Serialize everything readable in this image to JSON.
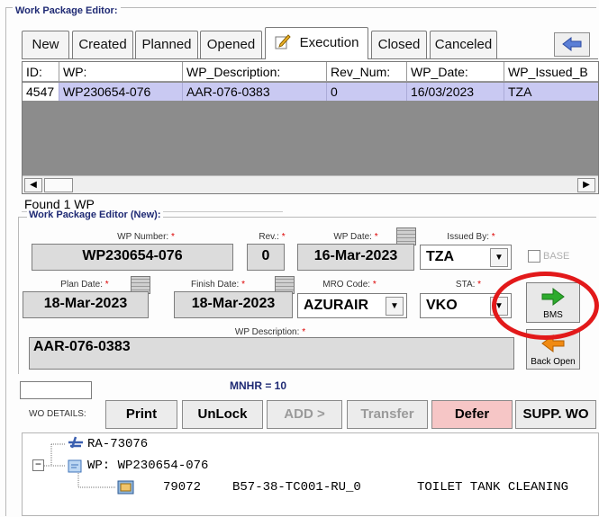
{
  "window": {
    "title": "Work Package Editor:"
  },
  "tabs": [
    {
      "label": "New"
    },
    {
      "label": "Created"
    },
    {
      "label": "Planned"
    },
    {
      "label": "Opened"
    },
    {
      "label": "Execution",
      "active": true
    },
    {
      "label": "Closed"
    },
    {
      "label": "Canceled"
    }
  ],
  "grid": {
    "columns": [
      "ID:",
      "WP:",
      "WP_Description:",
      "Rev_Num:",
      "WP_Date:",
      "WP_Issued_B"
    ],
    "rows": [
      [
        "4547",
        "WP230654-076",
        "AAR-076-0383",
        "0",
        "16/03/2023",
        "TZA"
      ]
    ]
  },
  "status": {
    "found": "Found 1 WP"
  },
  "editor": {
    "title": "Work Package Editor (New):",
    "wp_number": {
      "label": "WP Number:",
      "value": "WP230654-076"
    },
    "rev": {
      "label": "Rev.:",
      "value": "0"
    },
    "wp_date": {
      "label": "WP Date:",
      "value": "16-Mar-2023"
    },
    "issued_by": {
      "label": "Issued By:",
      "value": "TZA"
    },
    "base": {
      "label": "BASE"
    },
    "plan_date": {
      "label": "Plan Date:",
      "value": "18-Mar-2023"
    },
    "finish_date": {
      "label": "Finish Date:",
      "value": "18-Mar-2023"
    },
    "mro_code": {
      "label": "MRO Code:",
      "value": "AZURAIR"
    },
    "sta": {
      "label": "STA:",
      "value": "VKO"
    },
    "description": {
      "label": "WP Description:",
      "value": "AAR-076-0383"
    },
    "bms_button": "BMS",
    "back_open_button": "Back Open",
    "required_marker": "*"
  },
  "mnhr": "MNHR = 10",
  "toolbar": {
    "wo_details": "WO DETAILS:",
    "print": "Print",
    "unlock": "UnLock",
    "add": "ADD >",
    "transfer": "Transfer",
    "defer": "Defer",
    "supp_wo": "SUPP. WO"
  },
  "tree": {
    "aircraft": "RA-73076",
    "wp": "WP: WP230654-076",
    "item_id": "79072",
    "item_code": "B57-38-TC001-RU_0",
    "item_desc": "TOILET TANK CLEANING"
  },
  "colors": {
    "selected_row": "#c9c9f2",
    "defer": "#f6c6c6",
    "highlight": "#e2191a",
    "green_arrow": "#2dab2d",
    "orange_arrow": "#f08a12"
  }
}
